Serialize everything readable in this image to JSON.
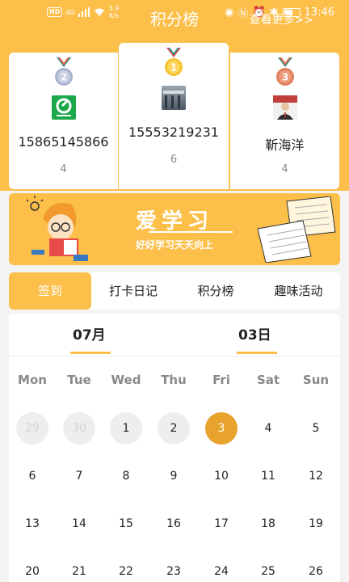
{
  "colors": {
    "accent": "#fcbf4a",
    "selected_day": "#e8a32d",
    "muted": "#888888"
  },
  "status_bar": {
    "hd": "HD",
    "net": "4G",
    "speed": "3.9",
    "speed_unit": "K/s",
    "time": "13:46"
  },
  "header": {
    "title": "积分榜",
    "view_more": "查看更多>>"
  },
  "podium": [
    {
      "rank": 2,
      "rank_label": "2",
      "name": "15865145866",
      "count": "4",
      "avatar": "app-logo-avatar"
    },
    {
      "rank": 1,
      "rank_label": "1",
      "name": "15553219231",
      "count": "6",
      "avatar": "photo-avatar"
    },
    {
      "rank": 3,
      "rank_label": "3",
      "name": "靳海洋",
      "count": "4",
      "avatar": "person-avatar"
    }
  ],
  "banner": {
    "title": "爱学习",
    "subtitle": "好好学习天天向上"
  },
  "tabs": [
    {
      "label": "签到",
      "active": true
    },
    {
      "label": "打卡日记",
      "active": false
    },
    {
      "label": "积分榜",
      "active": false
    },
    {
      "label": "趣味活动",
      "active": false
    }
  ],
  "calendar": {
    "month": "07月",
    "day": "03日",
    "weekdays": [
      "Mon",
      "Tue",
      "Wed",
      "Thu",
      "Fri",
      "Sat",
      "Sun"
    ],
    "rows": [
      [
        "29",
        "30",
        "1",
        "2",
        "3",
        "4",
        "5"
      ],
      [
        "6",
        "7",
        "8",
        "9",
        "10",
        "11",
        "12"
      ],
      [
        "13",
        "14",
        "15",
        "16",
        "17",
        "18",
        "19"
      ],
      [
        "20",
        "21",
        "22",
        "23",
        "24",
        "25",
        "26"
      ]
    ],
    "prev_month_days": [
      "29",
      "30"
    ],
    "checked_days": [
      "1",
      "2"
    ],
    "selected_day": "3"
  }
}
